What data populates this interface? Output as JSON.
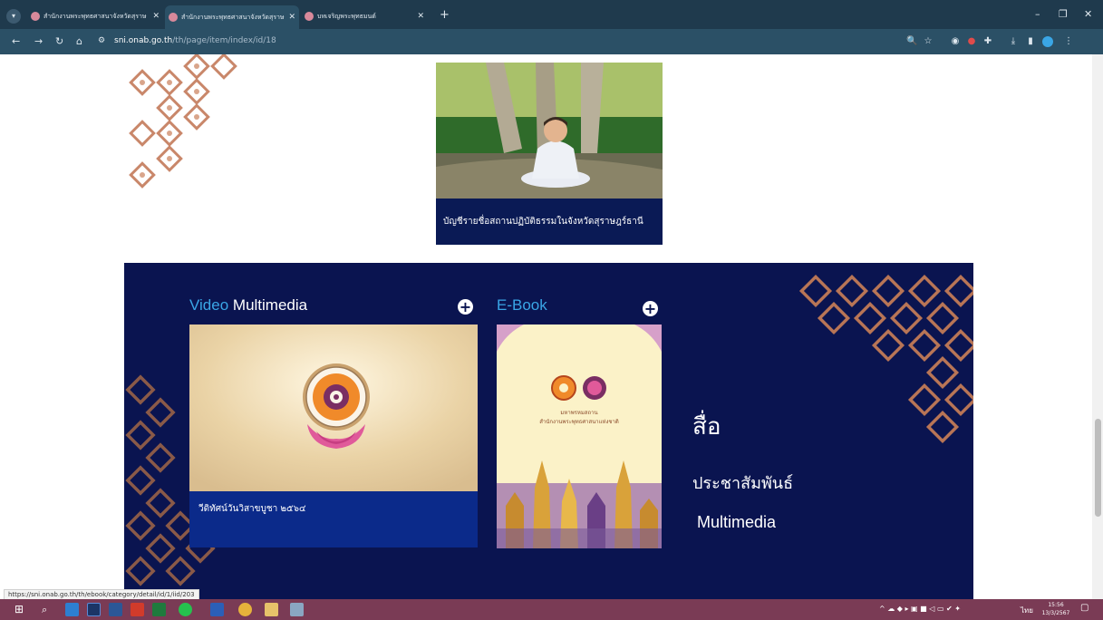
{
  "browser": {
    "tabs": [
      {
        "title": "สำนักงานพระพุทธศาสนาจังหวัดสุราษ"
      },
      {
        "title": "สำนักงานพระพุทธศาสนาจังหวัดสุราษ"
      },
      {
        "title": "บทเจริญพระพุทธมนต์"
      }
    ],
    "url_host": "sni.onab.go.th",
    "url_path": "/th/page/item/index/id/18",
    "status_url": "https://sni.onab.go.th/th/ebook/category/detail/id/1/iid/203"
  },
  "page": {
    "practice_card": {
      "caption": "บัญชีรายชื่อสถานปฏิบัติธรรมในจังหวัดสุราษฎร์ธานี"
    },
    "video_section": {
      "title_blue": "Video",
      "title_white": " Multimedia",
      "video_caption": "วีดิทัศน์วันวิสาขบูชา ๒๕๖๔"
    },
    "ebook_section": {
      "title": "E-Book",
      "cover_line1": "มหาพรหมสถาน",
      "cover_line2": "สำนักงานพระพุทธศาสนาแห่งชาติ"
    },
    "media": {
      "line1": "สื่อ",
      "line2": "ประชาสัมพันธ์",
      "line3": "Multimedia"
    }
  },
  "taskbar": {
    "tray_lang": "ไทย",
    "clock_time": "15:56",
    "clock_date": "13/3/2567"
  },
  "colors": {
    "band_bg": "#0a1450",
    "accent_blue": "#3aa6e6",
    "caption_bg": "#0b2a8a",
    "tabbar": "#1f3a4d",
    "taskbar": "#7a3b55"
  }
}
